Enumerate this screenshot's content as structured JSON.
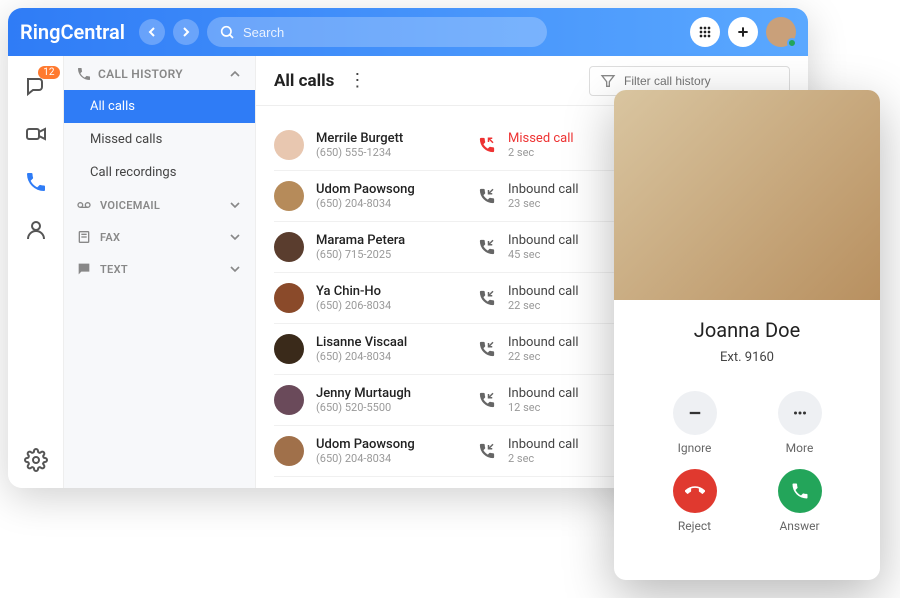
{
  "brand": "RingCentral",
  "search": {
    "placeholder": "Search"
  },
  "rail": {
    "badge": "12"
  },
  "sidebar": {
    "call_history": "CALL HISTORY",
    "items": {
      "all_calls": "All calls",
      "missed_calls": "Missed calls",
      "call_recordings": "Call recordings"
    },
    "voicemail": "VOICEMAIL",
    "fax": "FAX",
    "text": "TEXT"
  },
  "main": {
    "title": "All calls",
    "filter_placeholder": "Filter call history"
  },
  "calls": [
    {
      "name": "Merrile Burgett",
      "phone": "(650) 555-1234",
      "type": "Missed call",
      "duration": "2 sec",
      "missed": true
    },
    {
      "name": "Udom Paowsong",
      "phone": "(650) 204-8034",
      "type": "Inbound call",
      "duration": "23 sec",
      "missed": false
    },
    {
      "name": "Marama Petera",
      "phone": "(650) 715-2025",
      "type": "Inbound call",
      "duration": "45 sec",
      "missed": false
    },
    {
      "name": "Ya Chin-Ho",
      "phone": "(650) 206-8034",
      "type": "Inbound call",
      "duration": "22 sec",
      "missed": false
    },
    {
      "name": "Lisanne Viscaal",
      "phone": "(650) 204-8034",
      "type": "Inbound call",
      "duration": "22 sec",
      "missed": false
    },
    {
      "name": "Jenny Murtaugh",
      "phone": "(650) 520-5500",
      "type": "Inbound call",
      "duration": "12 sec",
      "missed": false
    },
    {
      "name": "Udom Paowsong",
      "phone": "(650) 204-8034",
      "type": "Inbound call",
      "duration": "2 sec",
      "missed": false
    }
  ],
  "incoming": {
    "name": "Joanna Doe",
    "ext": "Ext. 9160",
    "ignore": "Ignore",
    "more": "More",
    "reject": "Reject",
    "answer": "Answer"
  }
}
